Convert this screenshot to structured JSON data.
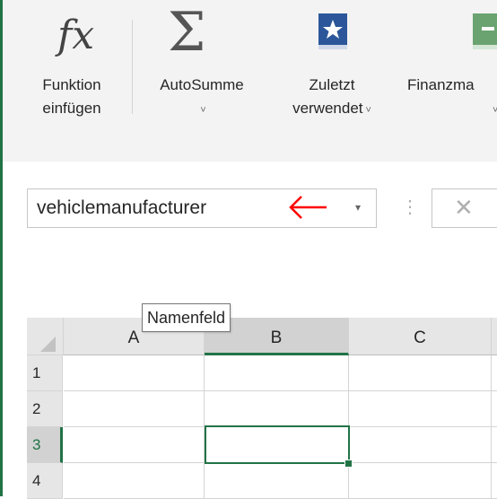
{
  "ribbon": {
    "insert_function": {
      "line1": "Funktion",
      "line2": "einfügen",
      "icon": "fx-icon"
    },
    "autosum": {
      "line1": "AutoSumme",
      "caret": "˅",
      "icon": "sigma-icon"
    },
    "recently_used": {
      "line1": "Zuletzt",
      "line2": "verwendet",
      "caret": "˅",
      "icon": "star-book-icon"
    },
    "financial": {
      "line1": "Finanzma",
      "caret": "˅",
      "icon": "financial-book-icon"
    }
  },
  "formula_bar": {
    "name_box_value": "vehiclemanufacturer",
    "dropdown_glyph": "▾",
    "separator_glyph": "⋮",
    "cancel_glyph": "✕",
    "annotation_arrow_color": "#ff0000"
  },
  "tooltip": {
    "text": "Namenfeld"
  },
  "grid": {
    "columns": [
      "A",
      "B",
      "C"
    ],
    "rows": [
      "1",
      "2",
      "3",
      "4"
    ],
    "selected_column": "B",
    "selected_row": "3",
    "active_cell": "B3"
  },
  "colors": {
    "accent_green": "#217346",
    "annotation_red": "#ff0000"
  }
}
